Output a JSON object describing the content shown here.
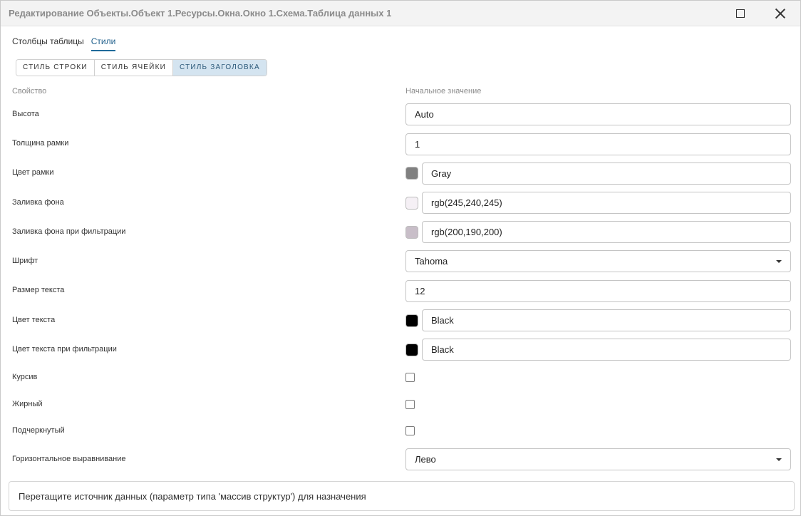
{
  "window": {
    "title": "Редактирование Объекты.Объект 1.Ресурсы.Окна.Окно 1.Схема.Таблица данных 1"
  },
  "tabs": [
    {
      "label": "Столбцы таблицы",
      "active": false
    },
    {
      "label": "Стили",
      "active": true
    }
  ],
  "style_tabs": [
    {
      "label": "СТИЛЬ СТРОКИ",
      "active": false
    },
    {
      "label": "СТИЛЬ ЯЧЕЙКИ",
      "active": false
    },
    {
      "label": "СТИЛЬ ЗАГОЛОВКА",
      "active": true
    }
  ],
  "columns": {
    "property": "Свойство",
    "initial_value": "Начальное значение"
  },
  "properties": {
    "height": {
      "label": "Высота",
      "value": "Auto"
    },
    "border_width": {
      "label": "Толщина рамки",
      "value": "1"
    },
    "border_color": {
      "label": "Цвет рамки",
      "value": "Gray",
      "swatch": "#808080"
    },
    "background_fill": {
      "label": "Заливка фона",
      "value": "rgb(245,240,245)",
      "swatch": "#f5f0f5"
    },
    "filter_background_fill": {
      "label": "Заливка фона при фильтрации",
      "value": "rgb(200,190,200)",
      "swatch": "#c8bec8"
    },
    "font": {
      "label": "Шрифт",
      "value": "Tahoma"
    },
    "text_size": {
      "label": "Размер текста",
      "value": "12"
    },
    "text_color": {
      "label": "Цвет текста",
      "value": "Black",
      "swatch": "#000000"
    },
    "filter_text_color": {
      "label": "Цвет текста при фильтрации",
      "value": "Black",
      "swatch": "#000000"
    },
    "italic": {
      "label": "Курсив",
      "checked": false
    },
    "bold": {
      "label": "Жирный",
      "checked": false
    },
    "underline": {
      "label": "Подчеркнутый",
      "checked": false
    },
    "horizontal_alignment": {
      "label": "Горизонтальное выравнивание",
      "value": "Лево"
    }
  },
  "footer": {
    "hint": "Перетащите источник данных (параметр типа 'массив структур') для назначения"
  },
  "colors": {
    "accent": "#1f6a9a",
    "active_segment_bg": "#d4e4f0"
  },
  "icons": [
    "maximize-icon",
    "close-icon",
    "chevron-down-icon"
  ]
}
